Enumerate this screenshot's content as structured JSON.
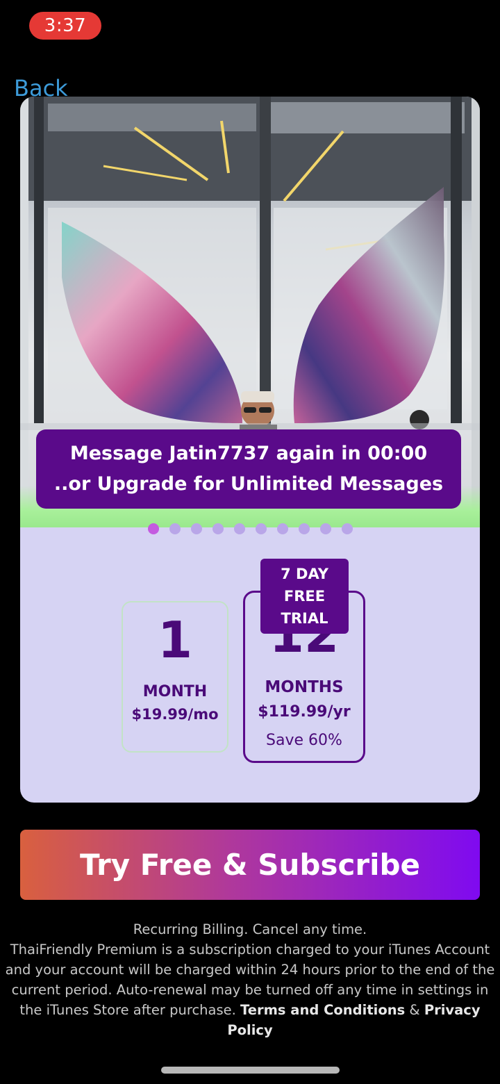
{
  "status_bar": {
    "time": "3:37"
  },
  "nav": {
    "back_label": "Back"
  },
  "banner": {
    "line1": "Message Jatin7737 again in 00:00",
    "line2": "..or Upgrade for Unlimited Messages"
  },
  "carousel": {
    "total": 10,
    "active": 0
  },
  "plans": [
    {
      "number": "1",
      "unit": "MONTH",
      "price": "$19.99/mo",
      "selected": false
    },
    {
      "number": "12",
      "unit": "MONTHS",
      "price": "$119.99/yr",
      "savings": "Save 60%",
      "selected": true
    }
  ],
  "trial_badge": {
    "line1": "7 DAY",
    "line2": "FREE",
    "line3": "TRIAL"
  },
  "cta": {
    "label": "Try Free & Subscribe"
  },
  "legal": {
    "line1": "Recurring Billing. Cancel any time.",
    "body": "ThaiFriendly Premium is a subscription charged to your iTunes Account and your account will be charged within 24 hours prior to the end of the current period. Auto-renewal may be turned off any time in settings in the iTunes Store after purchase.",
    "terms_label": "Terms and Conditions",
    "amp": "&",
    "privacy_label": "Privacy Policy"
  },
  "colors": {
    "accent_purple": "#5a0a8a",
    "card_bg": "#d6d3f3",
    "back_link": "#3d9bd9",
    "status_pill": "#e53935"
  }
}
